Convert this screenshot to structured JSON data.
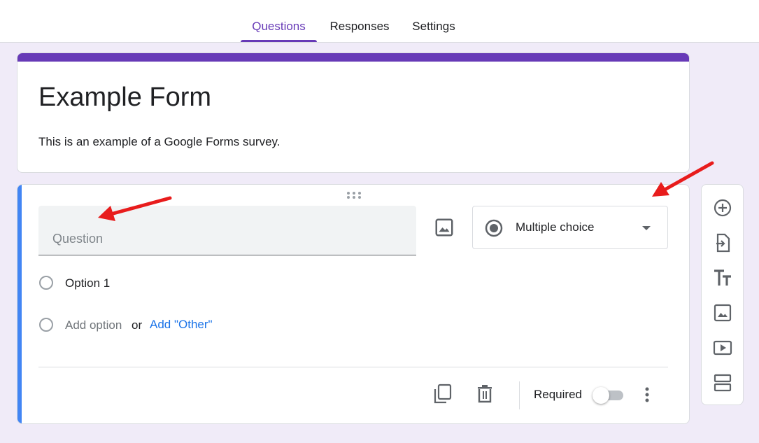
{
  "tabs": [
    {
      "label": "Questions",
      "active": true
    },
    {
      "label": "Responses",
      "active": false
    },
    {
      "label": "Settings",
      "active": false
    }
  ],
  "form": {
    "title": "Example Form",
    "description": "This is an example of a Google Forms survey."
  },
  "question": {
    "placeholder": "Question",
    "value": "",
    "type": "Multiple choice",
    "options": [
      "Option 1"
    ],
    "add_option": "Add option",
    "or": "or",
    "add_other": "Add \"Other\"",
    "required_label": "Required",
    "required": false
  },
  "sidebar_tools": [
    "add-question-icon",
    "import-questions-icon",
    "add-title-icon",
    "add-image-icon",
    "add-video-icon",
    "add-section-icon"
  ],
  "colors": {
    "accent": "#673ab7",
    "background": "#f0ebf8",
    "active_question": "#4285f4",
    "link": "#1a73e8",
    "annotation_arrow": "#e81c1c"
  }
}
